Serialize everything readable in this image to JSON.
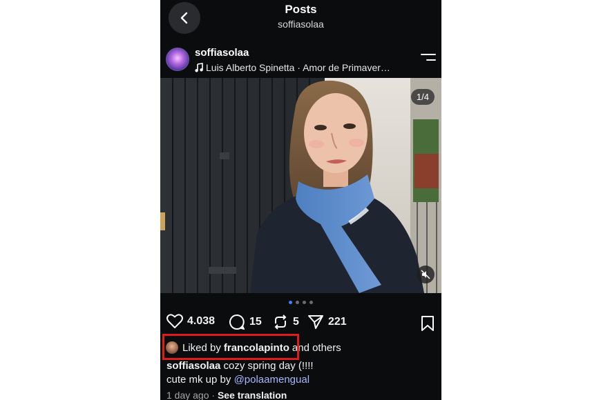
{
  "header": {
    "title": "Posts",
    "subtitle": "soffiasolaa"
  },
  "post": {
    "username": "soffiasolaa",
    "music": "Luis Alberto Spinetta · Amor de Primaver…",
    "image_counter": "1/4",
    "carousel": {
      "total": 4,
      "active": 1
    },
    "likes": "4.038",
    "comments": "15",
    "reposts": "5",
    "shares": "221",
    "liked_by": {
      "prefix": "Liked by",
      "user": "francolapinto",
      "suffix": "and others"
    },
    "caption": {
      "author": "soffiasolaa",
      "text1": "cozy spring day (!!!!",
      "text2": "cute mk up by",
      "mention": "@polaamengual"
    },
    "time": "1 day ago",
    "separator": "·",
    "see_translation": "See translation"
  },
  "colors": {
    "background": "#0b0c0e",
    "highlight": "#e01b1b",
    "mention": "#a8b8ff",
    "active_dot": "#3b82f6"
  },
  "icons": [
    "back-icon",
    "music-note-icon",
    "menu-icon",
    "heart-icon",
    "comment-icon",
    "repost-icon",
    "share-icon",
    "bookmark-icon",
    "mute-icon"
  ]
}
